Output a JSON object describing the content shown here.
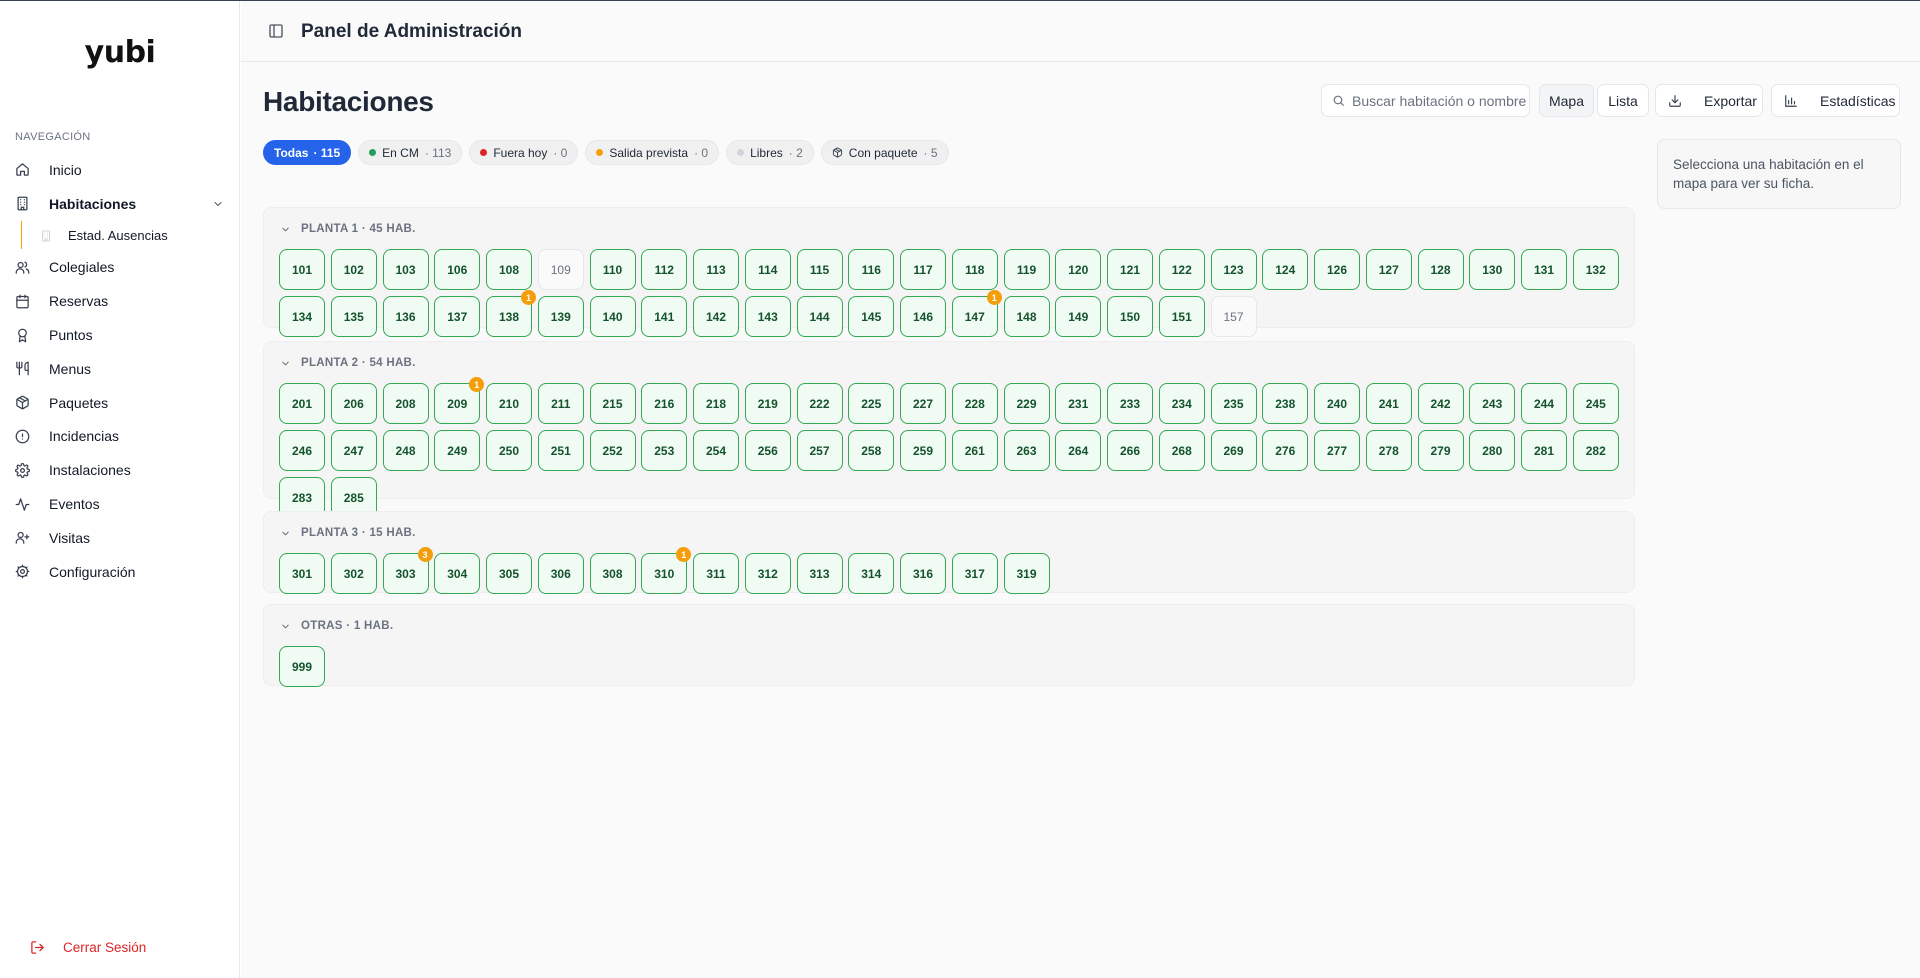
{
  "app": {
    "logo": "yubi",
    "header_title": "Panel de Administración"
  },
  "sidebar": {
    "heading": "NAVEGACIÓN",
    "items": [
      {
        "label": "Inicio",
        "icon": "home-icon"
      },
      {
        "label": "Habitaciones",
        "icon": "building-icon",
        "active": true
      },
      {
        "label": "Colegiales",
        "icon": "users-icon"
      },
      {
        "label": "Reservas",
        "icon": "calendar-icon"
      },
      {
        "label": "Puntos",
        "icon": "award-icon"
      },
      {
        "label": "Menus",
        "icon": "utensils-icon"
      },
      {
        "label": "Paquetes",
        "icon": "package-icon"
      },
      {
        "label": "Incidencias",
        "icon": "alert-circle-icon"
      },
      {
        "label": "Instalaciones",
        "icon": "settings-icon"
      },
      {
        "label": "Eventos",
        "icon": "activity-icon"
      },
      {
        "label": "Visitas",
        "icon": "user-plus-icon"
      },
      {
        "label": "Configuración",
        "icon": "gear-icon"
      }
    ],
    "subitem": "Estad. Ausencias",
    "logout": "Cerrar Sesión"
  },
  "main": {
    "title": "Habitaciones",
    "search_placeholder": "Buscar habitación o nombre",
    "view_buttons": {
      "map": "Mapa",
      "list": "Lista"
    },
    "export": "Exportar",
    "stats": "Estadísticas",
    "side_panel": "Selecciona una habitación en el mapa para ver su ficha."
  },
  "filters": [
    {
      "label": "Todas",
      "count": "· 115",
      "active": true
    },
    {
      "label": "En CM",
      "count": "· 113",
      "dot": "#22a05a"
    },
    {
      "label": "Fuera hoy",
      "count": "· 0",
      "dot": "#dc2626"
    },
    {
      "label": "Salida prevista",
      "count": "· 0",
      "dot": "#f59e0b"
    },
    {
      "label": "Libres",
      "count": "· 2",
      "dot": "#d1d5db"
    },
    {
      "label": "Con paquete",
      "count": "· 5",
      "icon": "package-icon"
    }
  ],
  "colors": {
    "accent": "#2563eb",
    "room_border": "#34a853",
    "room_bg": "#f0fbf3",
    "badge": "#f59e0b",
    "logout": "#dc2626"
  },
  "floors": [
    {
      "label": "PLANTA 1 · 45 HAB.",
      "rooms": [
        {
          "n": "101"
        },
        {
          "n": "102"
        },
        {
          "n": "103"
        },
        {
          "n": "106"
        },
        {
          "n": "108"
        },
        {
          "n": "109",
          "free": true
        },
        {
          "n": "110"
        },
        {
          "n": "112"
        },
        {
          "n": "113"
        },
        {
          "n": "114"
        },
        {
          "n": "115"
        },
        {
          "n": "116"
        },
        {
          "n": "117"
        },
        {
          "n": "118"
        },
        {
          "n": "119"
        },
        {
          "n": "120"
        },
        {
          "n": "121"
        },
        {
          "n": "122"
        },
        {
          "n": "123"
        },
        {
          "n": "124"
        },
        {
          "n": "126"
        },
        {
          "n": "127"
        },
        {
          "n": "128"
        },
        {
          "n": "130"
        },
        {
          "n": "131"
        },
        {
          "n": "132"
        },
        {
          "n": "134"
        },
        {
          "n": "135"
        },
        {
          "n": "136"
        },
        {
          "n": "137"
        },
        {
          "n": "138",
          "badge": "1"
        },
        {
          "n": "139"
        },
        {
          "n": "140"
        },
        {
          "n": "141"
        },
        {
          "n": "142"
        },
        {
          "n": "143"
        },
        {
          "n": "144"
        },
        {
          "n": "145"
        },
        {
          "n": "146"
        },
        {
          "n": "147",
          "badge": "1"
        },
        {
          "n": "148"
        },
        {
          "n": "149"
        },
        {
          "n": "150"
        },
        {
          "n": "151"
        },
        {
          "n": "157",
          "free": true
        }
      ]
    },
    {
      "label": "PLANTA 2 · 54 HAB.",
      "rooms": [
        {
          "n": "201"
        },
        {
          "n": "206"
        },
        {
          "n": "208"
        },
        {
          "n": "209",
          "badge": "1"
        },
        {
          "n": "210"
        },
        {
          "n": "211"
        },
        {
          "n": "215"
        },
        {
          "n": "216"
        },
        {
          "n": "218"
        },
        {
          "n": "219"
        },
        {
          "n": "222"
        },
        {
          "n": "225"
        },
        {
          "n": "227"
        },
        {
          "n": "228"
        },
        {
          "n": "229"
        },
        {
          "n": "231"
        },
        {
          "n": "233"
        },
        {
          "n": "234"
        },
        {
          "n": "235"
        },
        {
          "n": "238"
        },
        {
          "n": "240"
        },
        {
          "n": "241"
        },
        {
          "n": "242"
        },
        {
          "n": "243"
        },
        {
          "n": "244"
        },
        {
          "n": "245"
        },
        {
          "n": "246"
        },
        {
          "n": "247"
        },
        {
          "n": "248"
        },
        {
          "n": "249"
        },
        {
          "n": "250"
        },
        {
          "n": "251"
        },
        {
          "n": "252"
        },
        {
          "n": "253"
        },
        {
          "n": "254"
        },
        {
          "n": "256"
        },
        {
          "n": "257"
        },
        {
          "n": "258"
        },
        {
          "n": "259"
        },
        {
          "n": "261"
        },
        {
          "n": "263"
        },
        {
          "n": "264"
        },
        {
          "n": "266"
        },
        {
          "n": "268"
        },
        {
          "n": "269"
        },
        {
          "n": "276"
        },
        {
          "n": "277"
        },
        {
          "n": "278"
        },
        {
          "n": "279"
        },
        {
          "n": "280"
        },
        {
          "n": "281"
        },
        {
          "n": "282"
        },
        {
          "n": "283"
        },
        {
          "n": "285"
        }
      ]
    },
    {
      "label": "PLANTA 3 · 15 HAB.",
      "rooms": [
        {
          "n": "301"
        },
        {
          "n": "302"
        },
        {
          "n": "303",
          "badge": "3"
        },
        {
          "n": "304"
        },
        {
          "n": "305"
        },
        {
          "n": "306"
        },
        {
          "n": "308"
        },
        {
          "n": "310",
          "badge": "1"
        },
        {
          "n": "311"
        },
        {
          "n": "312"
        },
        {
          "n": "313"
        },
        {
          "n": "314"
        },
        {
          "n": "316"
        },
        {
          "n": "317"
        },
        {
          "n": "319"
        }
      ]
    },
    {
      "label": "OTRAS · 1 HAB.",
      "rooms": [
        {
          "n": "999"
        }
      ]
    }
  ]
}
